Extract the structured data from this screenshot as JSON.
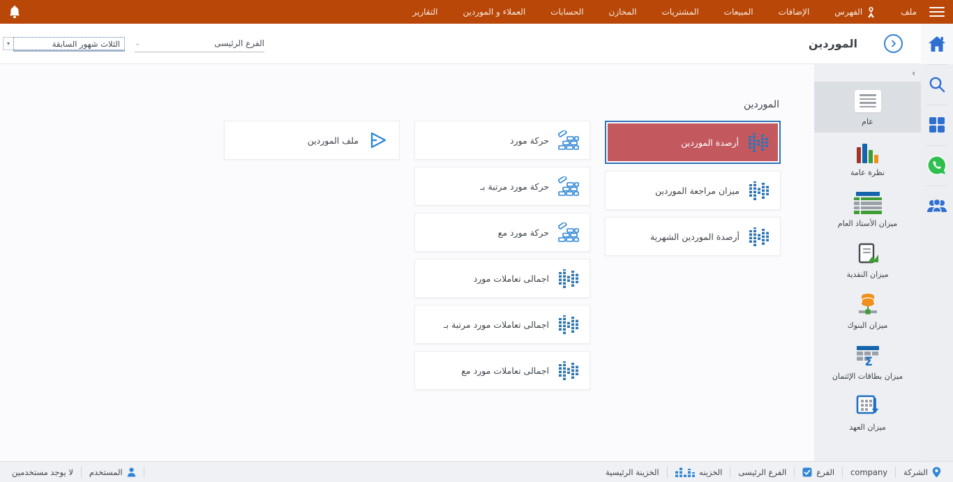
{
  "colors": {
    "topbar_bg": "#b84708",
    "accent_blue": "#2e75b6",
    "icon_blue": "#2f6fd0",
    "selected_red": "#c3585f",
    "whatsapp_green": "#2fbf4f",
    "sidebar_bg": "#edeff2",
    "sidebar_selected_bg": "#dbdee3"
  },
  "topbar": {
    "menu": [
      {
        "label": "ملف"
      },
      {
        "label": "الفهرس",
        "icon": "ribbon-icon"
      },
      {
        "label": "الإضافات"
      },
      {
        "label": "المبيعات"
      },
      {
        "label": "المشتريات"
      },
      {
        "label": "المخازن"
      },
      {
        "label": "الحسابات"
      },
      {
        "label": "العملاء و الموردين"
      },
      {
        "label": "التقارير"
      }
    ]
  },
  "header": {
    "title": "الموردين",
    "fields": {
      "branch": {
        "value": "الفرع الرئيسى"
      },
      "period": {
        "value": "الثلاث شهور السابقة",
        "arrow": "▾"
      }
    }
  },
  "iconbar": {
    "items": [
      "home-icon",
      "search-icon",
      "apps-icon",
      "whatsapp-icon",
      "users-icon"
    ]
  },
  "sidebar": {
    "collapse_arrow": "›",
    "items": [
      {
        "label": "عام",
        "icon": "general-icon",
        "selected": true
      },
      {
        "label": "نظرة عامة",
        "icon": "overview-bars-icon"
      },
      {
        "label": "ميزان الأستاذ العام",
        "icon": "ledger-table-icon"
      },
      {
        "label": "ميزان النقدية",
        "icon": "cash-report-icon"
      },
      {
        "label": "ميزان البنوك",
        "icon": "bank-coins-icon"
      },
      {
        "label": "ميزان بطاقات الإئتمان",
        "icon": "credit-sigma-icon"
      },
      {
        "label": "ميزان العهد",
        "icon": "custody-grid-icon"
      }
    ]
  },
  "content": {
    "section_title": "الموردين",
    "columns": [
      {
        "cards": [
          {
            "label": "أرصدة الموردين",
            "icon": "stats-bars-icon",
            "selected": true
          },
          {
            "label": "ميزان مراجعة الموردين",
            "icon": "stats-bars-icon"
          },
          {
            "label": "أرصدة الموردين الشهرية",
            "icon": "stats-bars-icon"
          }
        ]
      },
      {
        "cards": [
          {
            "label": "حركة مورد",
            "icon": "bricks-icon"
          },
          {
            "label": "حركة مورد مرتبة بـ",
            "icon": "bricks-icon"
          },
          {
            "label": "حركة مورد مع",
            "icon": "bricks-icon"
          },
          {
            "label": "اجمالى تعاملات مورد",
            "icon": "stats-bars-icon"
          },
          {
            "label": "اجمالى تعاملات مورد مرتبة بـ",
            "icon": "stats-bars-icon"
          },
          {
            "label": "اجمالى تعاملات مورد مع",
            "icon": "stats-bars-icon"
          }
        ]
      },
      {
        "cards": [
          {
            "label": "ملف الموردين",
            "icon": "file-play-icon"
          }
        ]
      }
    ]
  },
  "statusbar": {
    "company_label": "الشركة",
    "company_value": "company",
    "branch_label": "الفرع",
    "branch_value": "الفرع الرئيسى",
    "treasury_label": "الخزينه",
    "treasury_value": "الخزينة الرئيسية",
    "user_label": "المستخدم",
    "user_value": "لا يوجد مستخدمين"
  }
}
